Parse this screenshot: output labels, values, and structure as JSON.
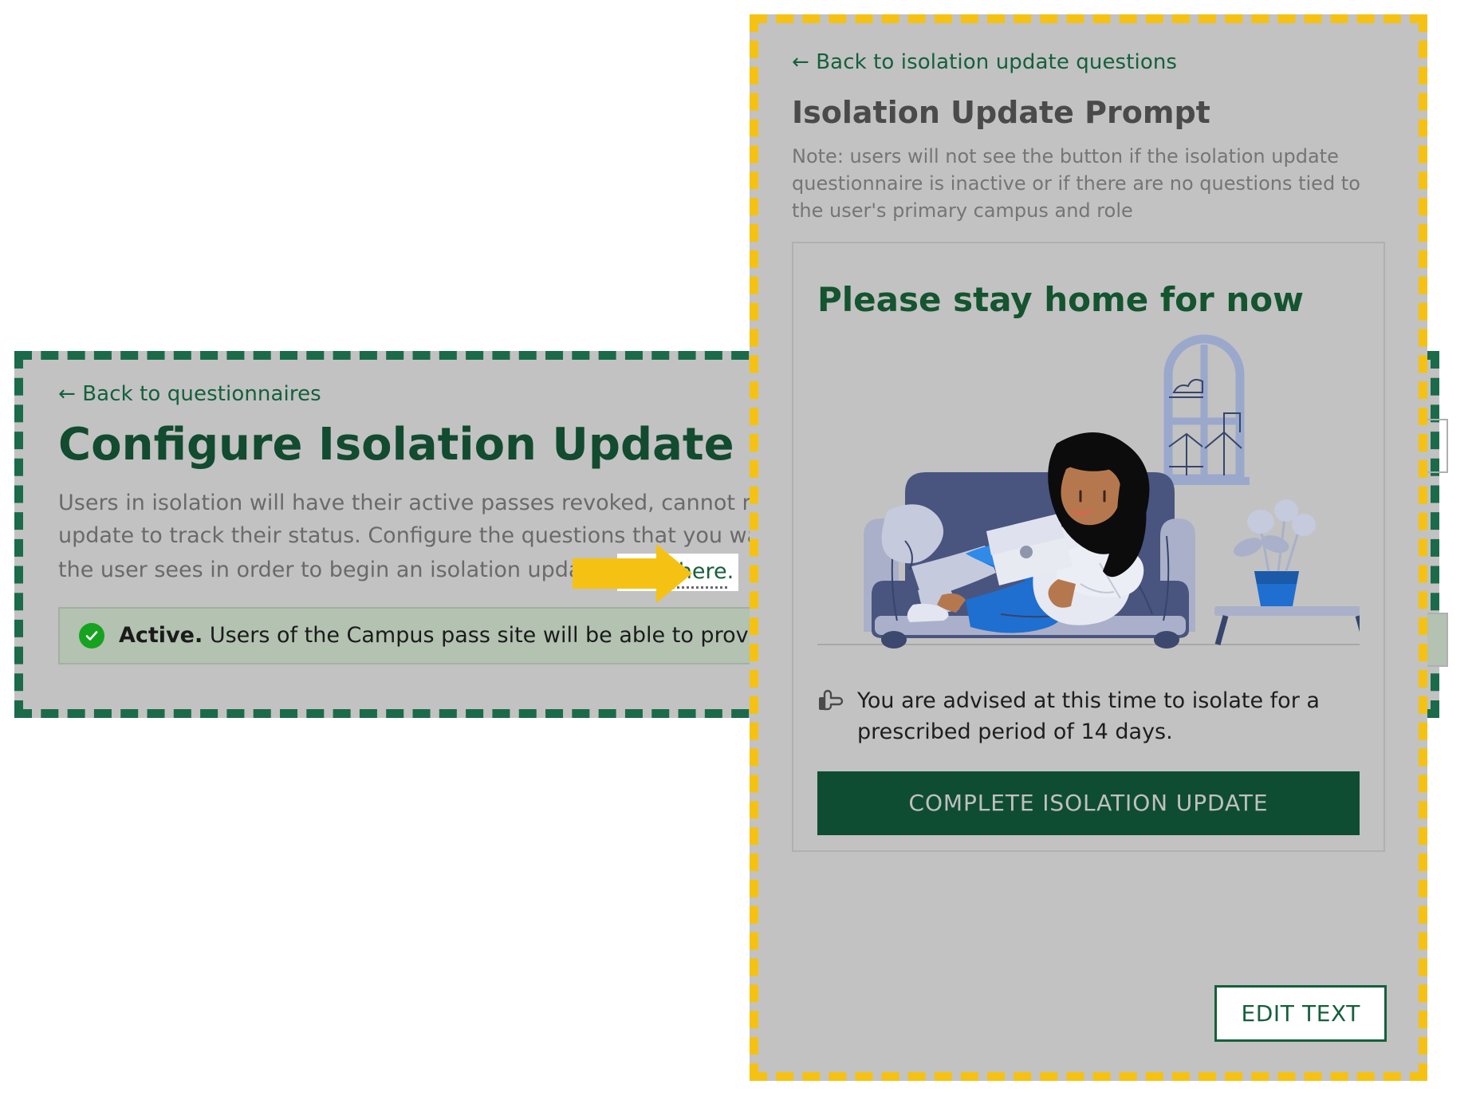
{
  "left_panel": {
    "back_link": "← Back to questionnaires",
    "title": "Configure Isolation Update Questionnaire",
    "body_line_1": "Users in isolation will have their active passes revoked, cannot request new",
    "body_line_2": "update to track their status. Configure the questions that you want users to",
    "body_line_3": "the user sees in order to begin an isolation update,",
    "click_here_label": "click here",
    "click_here_period": ".",
    "status": {
      "icon": "check-circle-icon",
      "bold_label": "Active.",
      "message": "Users of the Campus pass site will be able to provide isolation updates."
    }
  },
  "right_panel": {
    "back_link": "← Back to isolation update questions",
    "title": "Isolation Update Prompt",
    "note": "Note: users will not see the button if the isolation update questionnaire is inactive or if there are no questions tied to the user's primary campus and role",
    "preview": {
      "heading": "Please stay home for now",
      "illustration_name": "woman-reading-on-couch-illustration",
      "advice_icon": "pointing-hand-icon",
      "advice_text": "You are advised at this time to isolate for a prescribed period of 14 days.",
      "complete_button_label": "COMPLETE ISOLATION UPDATE"
    },
    "edit_button_label": "EDIT TEXT"
  },
  "annotation": {
    "arrow_name": "yellow-callout-arrow",
    "left_highlight_color": "#1b6b4a",
    "right_highlight_color": "#f5c213"
  },
  "colors": {
    "panel_background": "#c2c2c2",
    "brand_green": "#15603c",
    "button_green": "#0f4d32",
    "status_banner": "#b3c2b1",
    "accent_yellow": "#f5c213"
  }
}
